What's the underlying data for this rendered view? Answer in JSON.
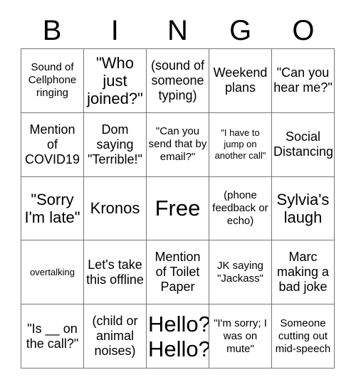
{
  "header": {
    "letters": [
      "B",
      "I",
      "N",
      "G",
      "O"
    ]
  },
  "grid": {
    "rows": [
      [
        {
          "text": "Sound of Cellphone ringing",
          "size": "sz-sm"
        },
        {
          "text": "\"Who just joined?\"",
          "size": "sz-lg"
        },
        {
          "text": "(sound of someone typing)",
          "size": "sz-md"
        },
        {
          "text": "Weekend plans",
          "size": "sz-md"
        },
        {
          "text": "\"Can you hear me?\"",
          "size": "sz-md"
        }
      ],
      [
        {
          "text": "Mention of COVID19",
          "size": "sz-md"
        },
        {
          "text": "Dom saying \"Terrible!\"",
          "size": "sz-md"
        },
        {
          "text": "\"Can you send that by email?\"",
          "size": "sz-sm"
        },
        {
          "text": "\"I have to jump on another call\"",
          "size": "sz-xs"
        },
        {
          "text": "Social Distancing",
          "size": "sz-md"
        }
      ],
      [
        {
          "text": "\"Sorry I'm late\"",
          "size": "sz-lg"
        },
        {
          "text": "Kronos",
          "size": "sz-lg"
        },
        {
          "text": "Free",
          "size": "sz-xl"
        },
        {
          "text": "(phone feedback or echo)",
          "size": "sz-sm"
        },
        {
          "text": "Sylvia's laugh",
          "size": "sz-lg"
        }
      ],
      [
        {
          "text": "overtalking",
          "size": "sz-xs"
        },
        {
          "text": "Let's take this offline",
          "size": "sz-md"
        },
        {
          "text": "Mention of Toilet Paper",
          "size": "sz-md"
        },
        {
          "text": "JK saying \"Jackass\"",
          "size": "sz-sm"
        },
        {
          "text": "Marc making a bad joke",
          "size": "sz-md"
        }
      ],
      [
        {
          "text": "\"Is __ on the call?\"",
          "size": "sz-md"
        },
        {
          "text": "(child or animal noises)",
          "size": "sz-md"
        },
        {
          "text": "Hello? Hello?",
          "size": "sz-xl"
        },
        {
          "text": "\"I'm sorry; I was on mute\"",
          "size": "sz-sm"
        },
        {
          "text": "Someone cutting out mid-speech",
          "size": "sz-sm"
        }
      ]
    ]
  },
  "colors": {
    "background": "#ffffff",
    "text": "#000000",
    "border": "#767676"
  }
}
